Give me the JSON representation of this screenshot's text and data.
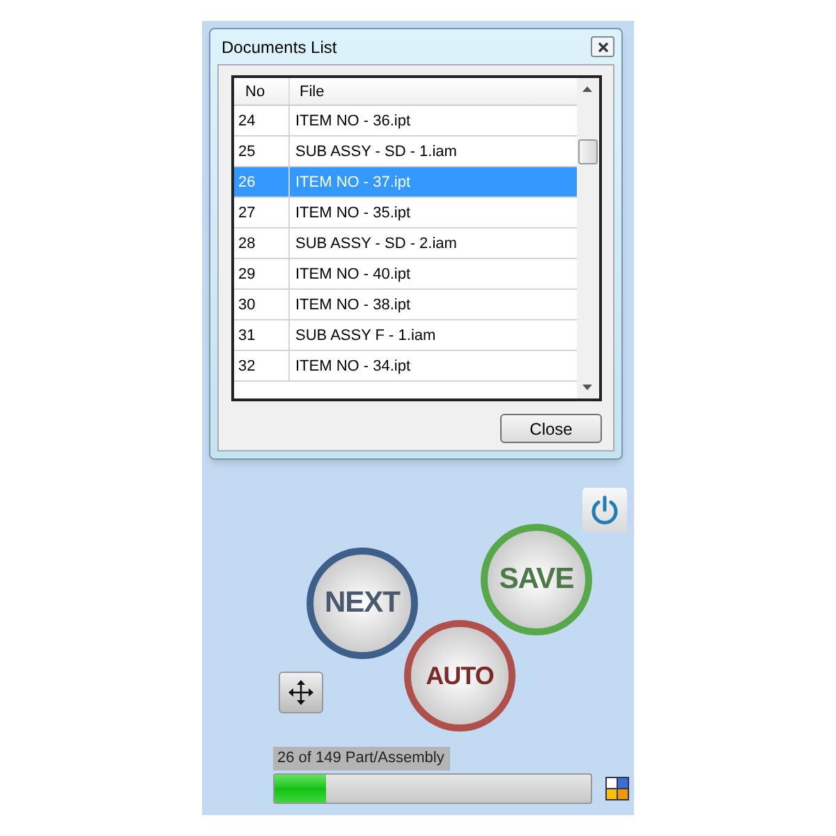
{
  "dialog": {
    "title": "Documents List",
    "columns": [
      "No",
      "File"
    ],
    "rows": [
      {
        "no": "24",
        "file": "ITEM NO - 36.ipt",
        "selected": false
      },
      {
        "no": "25",
        "file": "SUB ASSY - SD - 1.iam",
        "selected": false
      },
      {
        "no": "26",
        "file": "ITEM NO - 37.ipt",
        "selected": true
      },
      {
        "no": "27",
        "file": "ITEM NO - 35.ipt",
        "selected": false
      },
      {
        "no": "28",
        "file": "SUB ASSY - SD - 2.iam",
        "selected": false
      },
      {
        "no": "29",
        "file": "ITEM NO - 40.ipt",
        "selected": false
      },
      {
        "no": "30",
        "file": "ITEM NO - 38.ipt",
        "selected": false
      },
      {
        "no": "31",
        "file": "SUB ASSY F - 1.iam",
        "selected": false
      },
      {
        "no": "32",
        "file": "ITEM NO - 34.ipt",
        "selected": false
      }
    ],
    "close_button": "Close"
  },
  "buttons": [
    {
      "kind": "next",
      "label": "NEXT"
    },
    {
      "kind": "save",
      "label": "SAVE"
    },
    {
      "kind": "auto",
      "label": "AUTO"
    }
  ],
  "progress": {
    "label": "26 of 149 Part/Assembly",
    "level": 0.165
  }
}
